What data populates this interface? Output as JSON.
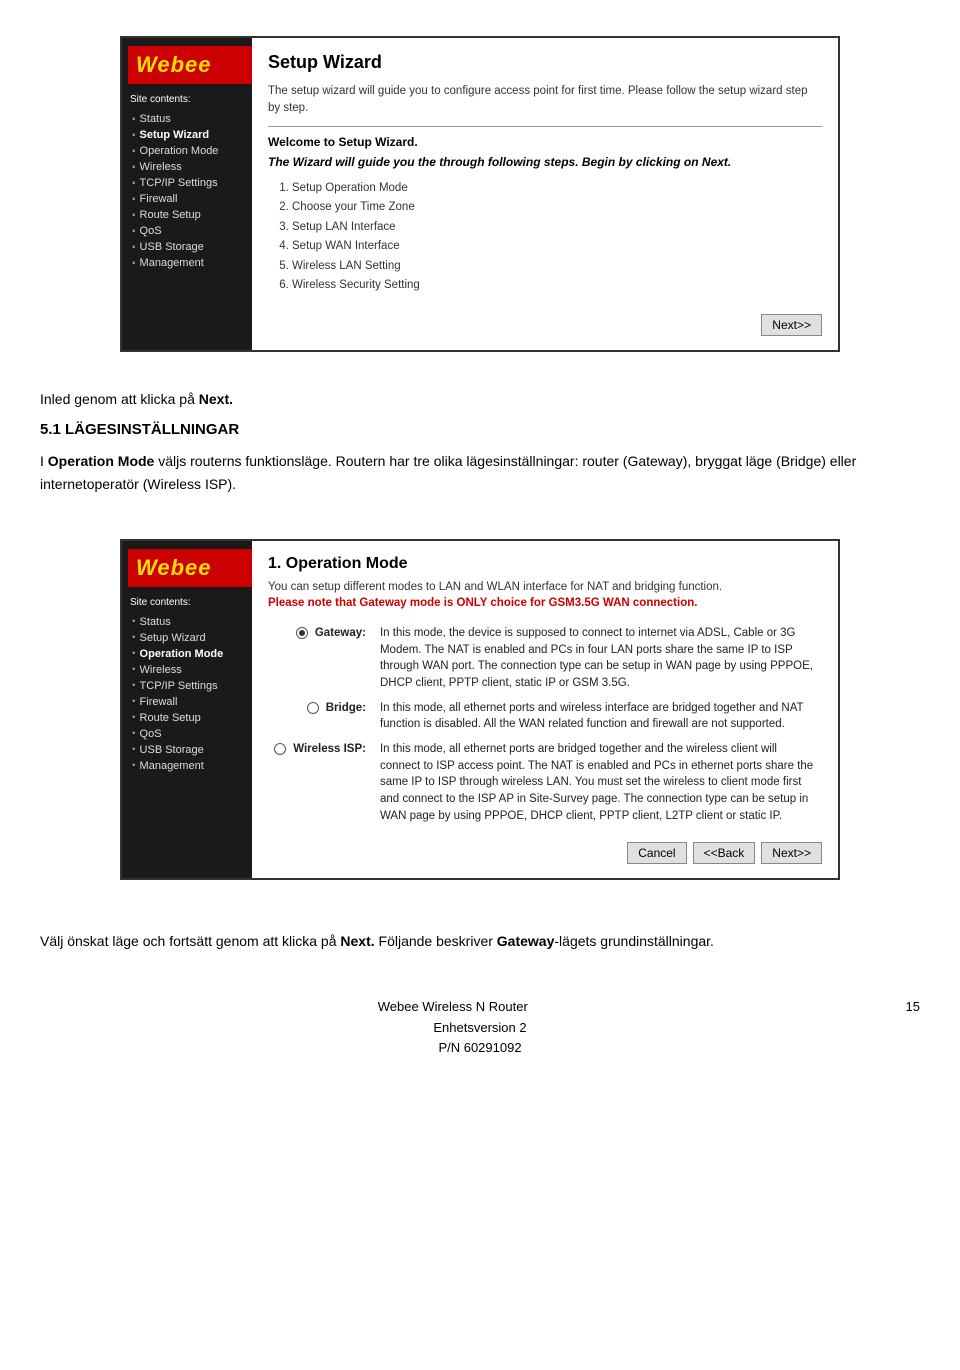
{
  "router1": {
    "logo": "Webee",
    "sidebar": {
      "section_title": "Site contents:",
      "items": [
        {
          "label": "Status",
          "active": false
        },
        {
          "label": "Setup Wizard",
          "active": true
        },
        {
          "label": "Operation Mode",
          "active": false
        },
        {
          "label": "Wireless",
          "active": false
        },
        {
          "label": "TCP/IP Settings",
          "active": false
        },
        {
          "label": "Firewall",
          "active": false
        },
        {
          "label": "Route Setup",
          "active": false
        },
        {
          "label": "QoS",
          "active": false
        },
        {
          "label": "USB Storage",
          "active": false
        },
        {
          "label": "Management",
          "active": false
        }
      ]
    },
    "main": {
      "title": "Setup Wizard",
      "description": "The setup wizard will guide you to configure access point for first time. Please follow the setup wizard step by step.",
      "welcome": "Welcome to Setup Wizard.",
      "note": "The Wizard will guide you the through following steps. Begin by clicking on Next.",
      "steps": [
        "Setup Operation Mode",
        "Choose your Time Zone",
        "Setup LAN Interface",
        "Setup WAN Interface",
        "Wireless LAN Setting",
        "Wireless Security Setting"
      ],
      "next_btn": "Next>>"
    }
  },
  "body1": {
    "text1": "Inled genom att klicka på ",
    "text1_bold": "Next.",
    "section": "5.1   LÄGESINSTÄLLNINGAR",
    "para1_prefix": "I ",
    "para1_bold": "Operation Mode",
    "para1_suffix": " väljs routerns funktionsläge. Routern har tre olika lägesinställningar: router (Gateway), bryggat läge (Bridge) eller internetoperatör (Wireless ISP)."
  },
  "router2": {
    "logo": "Webee",
    "sidebar": {
      "section_title": "Site contents:",
      "items": [
        {
          "label": "Status",
          "active": false
        },
        {
          "label": "Setup Wizard",
          "active": false
        },
        {
          "label": "Operation Mode",
          "active": true
        },
        {
          "label": "Wireless",
          "active": false
        },
        {
          "label": "TCP/IP Settings",
          "active": false
        },
        {
          "label": "Firewall",
          "active": false
        },
        {
          "label": "Route Setup",
          "active": false
        },
        {
          "label": "QoS",
          "active": false
        },
        {
          "label": "USB Storage",
          "active": false
        },
        {
          "label": "Management",
          "active": false
        }
      ]
    },
    "main": {
      "title": "1. Operation Mode",
      "description": "You can setup different modes to LAN and WLAN interface for NAT and bridging function.",
      "warning": "Please note that Gateway mode is ONLY choice for GSM3.5G WAN connection.",
      "modes": [
        {
          "label": "Gateway:",
          "selected": true,
          "text": "In this mode, the device is supposed to connect to internet via ADSL, Cable or 3G Modem. The NAT is enabled and PCs in four LAN ports share the same IP to ISP through WAN port. The connection type can be setup in WAN page by using PPPOE, DHCP client, PPTP client, static IP or GSM 3.5G."
        },
        {
          "label": "Bridge:",
          "selected": false,
          "text": "In this mode, all ethernet ports and wireless interface are bridged together and NAT function is disabled. All the WAN related function and firewall are not supported."
        },
        {
          "label": "Wireless ISP:",
          "selected": false,
          "text": "In this mode, all ethernet ports are bridged together and the wireless client will connect to ISP access point. The NAT is enabled and PCs in ethernet ports share the same IP to ISP through wireless LAN. You must set the wireless to client mode first and connect to the ISP AP in Site-Survey page. The connection type can be setup in WAN page by using PPPOE, DHCP client, PPTP client, L2TP client or static IP."
        }
      ],
      "cancel_btn": "Cancel",
      "back_btn": "<<Back",
      "next_btn": "Next>>"
    }
  },
  "body2": {
    "text1": "Välj önskat läge och fortsätt genom att klicka på ",
    "text1_bold": "Next.",
    "text2_prefix": "Följande beskriver ",
    "text2_bold": "Gateway",
    "text2_suffix": "-lägets grundinställningar."
  },
  "footer": {
    "line1": "Webee Wireless N Router",
    "line2": "Enhetsversion 2",
    "line3": "P/N 60291092",
    "page": "15"
  }
}
